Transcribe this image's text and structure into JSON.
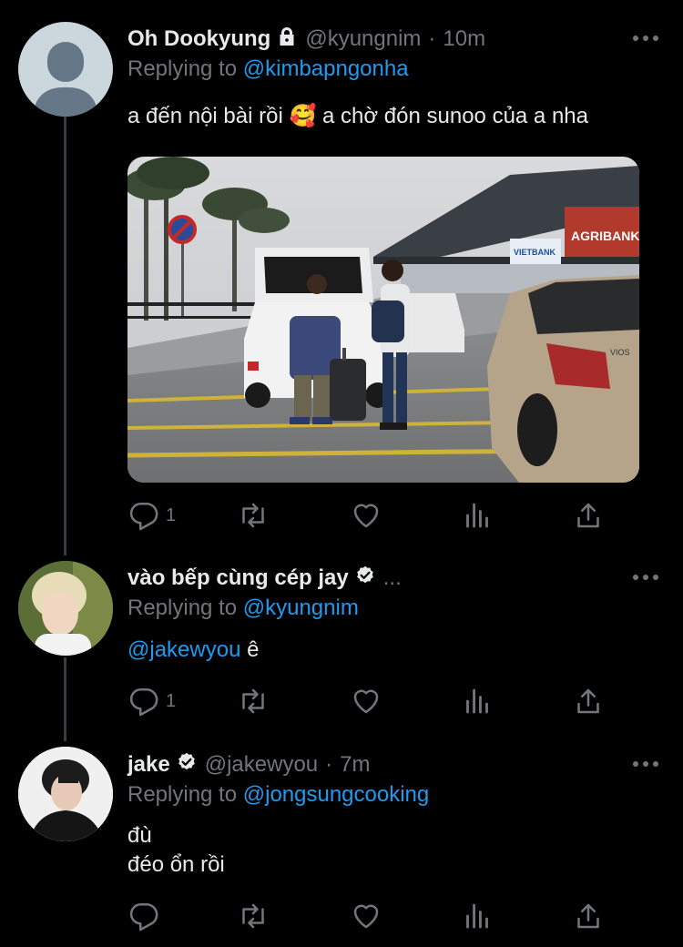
{
  "tweets": [
    {
      "name": "Oh Dookyung",
      "handle": "@kyungnim",
      "dot": "·",
      "time": "10m",
      "replying_prefix": "Replying to",
      "replying_to": "@kimbapngonha",
      "text_before_emoji": "a đến nội bài rồi",
      "emoji": "🥰",
      "text_after_emoji": "a chờ đón sunoo của a nha",
      "has_media": true,
      "media_signs": [
        "AGRIBANK",
        "VIETBANK",
        "VIOS"
      ],
      "reply_count": "1",
      "icons": [
        "locked-account-icon",
        "reply-icon",
        "retweet-icon",
        "like-icon",
        "analytics-icon",
        "share-icon",
        "more-icon"
      ]
    },
    {
      "name": "vào bếp cùng cép jay",
      "handle": "...",
      "replying_prefix": "Replying to",
      "replying_to": "@kyungnim",
      "mention": "@jakewyou",
      "text": " ê",
      "reply_count": "1",
      "icons": [
        "verified-badge-icon"
      ]
    },
    {
      "name": "jake",
      "handle": "@jakewyou",
      "dot": "·",
      "time": "7m",
      "replying_prefix": "Replying to",
      "replying_to": "@jongsungcooking",
      "text_line1": "đù",
      "text_line2": "đéo ổn rồi",
      "reply_count": "",
      "icons": [
        "verified-badge-icon"
      ]
    }
  ],
  "colors": {
    "background": "#000000",
    "text": "#e7e9ea",
    "muted": "#71767b",
    "link": "#1d9bf0",
    "thread_line": "#3a3d40"
  }
}
